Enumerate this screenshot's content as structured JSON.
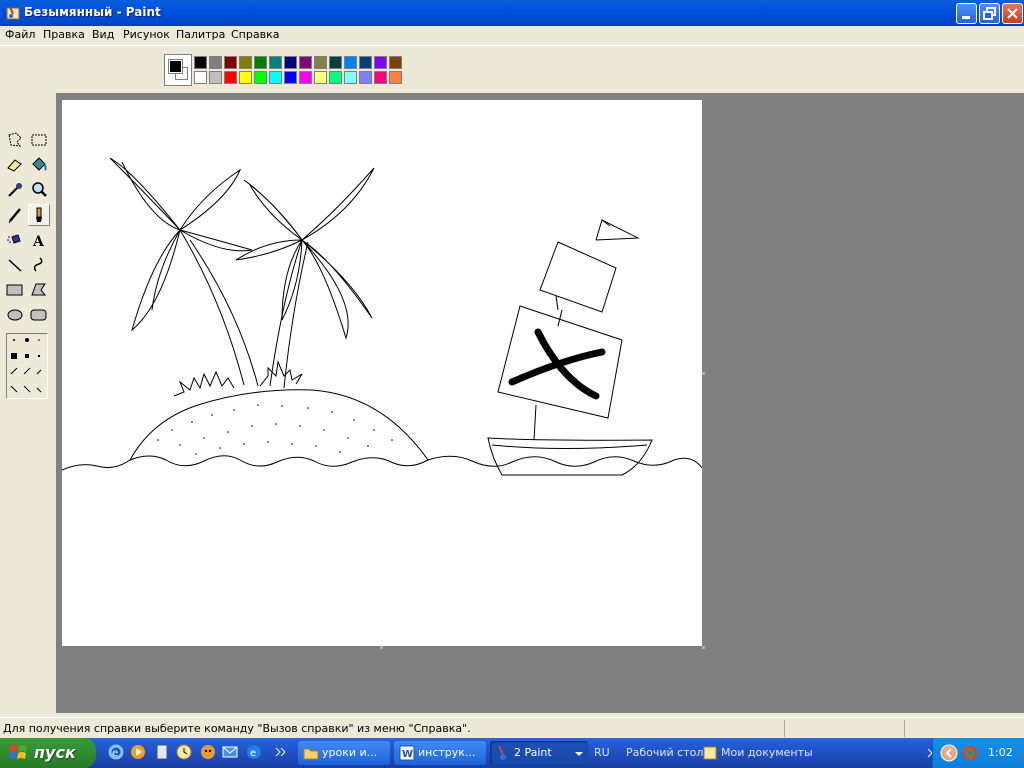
{
  "window": {
    "title": "Безымянный - Paint"
  },
  "menubar": {
    "items": [
      "Файл",
      "Правка",
      "Вид",
      "Рисунок",
      "Палитра",
      "Справка"
    ]
  },
  "palette": {
    "foreground": "#000000",
    "background": "#ffffff",
    "colors_top": [
      "#000000",
      "#808080",
      "#800000",
      "#808000",
      "#008000",
      "#008080",
      "#000080",
      "#800080",
      "#808040",
      "#004040",
      "#0080ff",
      "#004080",
      "#8000ff",
      "#804000"
    ],
    "colors_bottom": [
      "#ffffff",
      "#c0c0c0",
      "#ff0000",
      "#ffff00",
      "#00ff00",
      "#00ffff",
      "#0000ff",
      "#ff00ff",
      "#ffff80",
      "#00ff80",
      "#80ffff",
      "#8080ff",
      "#ff0080",
      "#ff8040"
    ]
  },
  "toolbox": {
    "tools": [
      "free-select",
      "rect-select",
      "eraser",
      "fill",
      "color-picker",
      "magnifier",
      "pencil",
      "brush",
      "airbrush",
      "text",
      "line",
      "curve",
      "rectangle",
      "polygon",
      "ellipse",
      "rounded-rectangle"
    ],
    "active_tool": "brush"
  },
  "statusbar": {
    "text": "Для получения справки выберите команду \"Вызов справки\" из меню \"Справка\"."
  },
  "taskbar": {
    "start_label": "пуск",
    "buttons": [
      "уроки и...",
      "инструк...",
      "2 Paint"
    ],
    "language": "RU",
    "toolbar_desktop": "Рабочий стол",
    "toolbar_docs": "Мои документы",
    "clock": "1:02"
  }
}
